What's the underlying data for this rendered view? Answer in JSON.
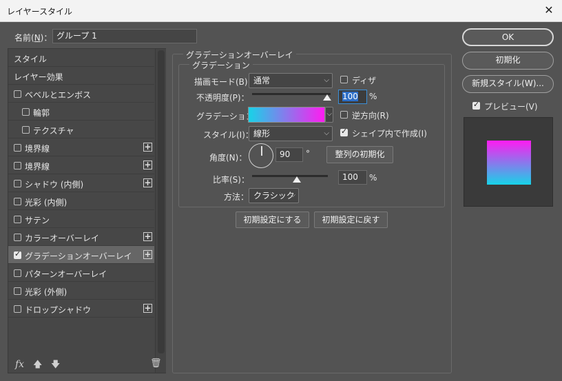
{
  "window": {
    "title": "レイヤースタイル"
  },
  "name": {
    "label": "名前(",
    "underline": "N",
    "label_end": ")：",
    "value": "グループ 1"
  },
  "style_list": {
    "items": [
      {
        "label": "スタイル",
        "checkbox": false,
        "checked": false,
        "plus": false,
        "selected": false,
        "indent": 0
      },
      {
        "label": "レイヤー効果",
        "checkbox": false,
        "checked": false,
        "plus": false,
        "selected": false,
        "indent": 0
      },
      {
        "label": "ベベルとエンボス",
        "checkbox": true,
        "checked": false,
        "plus": false,
        "selected": false,
        "indent": 0
      },
      {
        "label": "輪郭",
        "checkbox": true,
        "checked": false,
        "plus": false,
        "selected": false,
        "indent": 1
      },
      {
        "label": "テクスチャ",
        "checkbox": true,
        "checked": false,
        "plus": false,
        "selected": false,
        "indent": 1
      },
      {
        "label": "境界線",
        "checkbox": true,
        "checked": false,
        "plus": true,
        "selected": false,
        "indent": 0
      },
      {
        "label": "境界線",
        "checkbox": true,
        "checked": false,
        "plus": true,
        "selected": false,
        "indent": 0
      },
      {
        "label": "シャドウ (内側)",
        "checkbox": true,
        "checked": false,
        "plus": true,
        "selected": false,
        "indent": 0
      },
      {
        "label": "光彩 (内側)",
        "checkbox": true,
        "checked": false,
        "plus": false,
        "selected": false,
        "indent": 0
      },
      {
        "label": "サテン",
        "checkbox": true,
        "checked": false,
        "plus": false,
        "selected": false,
        "indent": 0
      },
      {
        "label": "カラーオーバーレイ",
        "checkbox": true,
        "checked": false,
        "plus": true,
        "selected": false,
        "indent": 0
      },
      {
        "label": "グラデーションオーバーレイ",
        "checkbox": true,
        "checked": true,
        "plus": true,
        "selected": true,
        "indent": 0
      },
      {
        "label": "パターンオーバーレイ",
        "checkbox": true,
        "checked": false,
        "plus": false,
        "selected": false,
        "indent": 0
      },
      {
        "label": "光彩 (外側)",
        "checkbox": true,
        "checked": false,
        "plus": false,
        "selected": false,
        "indent": 0
      },
      {
        "label": "ドロップシャドウ",
        "checkbox": true,
        "checked": false,
        "plus": true,
        "selected": false,
        "indent": 0
      }
    ],
    "footer_icons": [
      "fx-icon",
      "arrow-up-icon",
      "arrow-down-icon",
      "trash-icon"
    ],
    "fx_label": "fx"
  },
  "gradient_overlay": {
    "group_title": "グラデーションオーバーレイ",
    "sub_title": "グラデーション",
    "blend_mode": {
      "label": "描画モード(B)：",
      "value": "通常"
    },
    "dither": {
      "label": "ディザ",
      "checked": false
    },
    "opacity": {
      "label": "不透明度(P)：",
      "value": "100",
      "unit": "%",
      "level": 1.0
    },
    "gradient": {
      "label": "グラデーション：",
      "color_start": "#17d3e8",
      "color_end": "#ff1cf0"
    },
    "reverse": {
      "label": "逆方向(R)",
      "checked": false
    },
    "style": {
      "label": "スタイル(I)：",
      "value": "線形"
    },
    "align_with_layer": {
      "label": "シェイプ内で作成(I)",
      "checked": true
    },
    "angle": {
      "label": "角度(N)：",
      "value": "90",
      "unit": "°"
    },
    "reset_alignment": "整列の初期化",
    "scale": {
      "label": "比率(S)：",
      "value": "100",
      "unit": "%",
      "level": 0.5
    },
    "method": {
      "label": "方法：",
      "value": "クラシック"
    },
    "make_default": "初期設定にする",
    "reset_default": "初期設定に戻す"
  },
  "right": {
    "ok": "OK",
    "reset": "初期化",
    "new_style": "新規スタイル(W)...",
    "preview": {
      "label": "プレビュー(V)",
      "checked": true
    },
    "swatch_top": "#ff1cf0",
    "swatch_bottom": "#17d3e8"
  }
}
